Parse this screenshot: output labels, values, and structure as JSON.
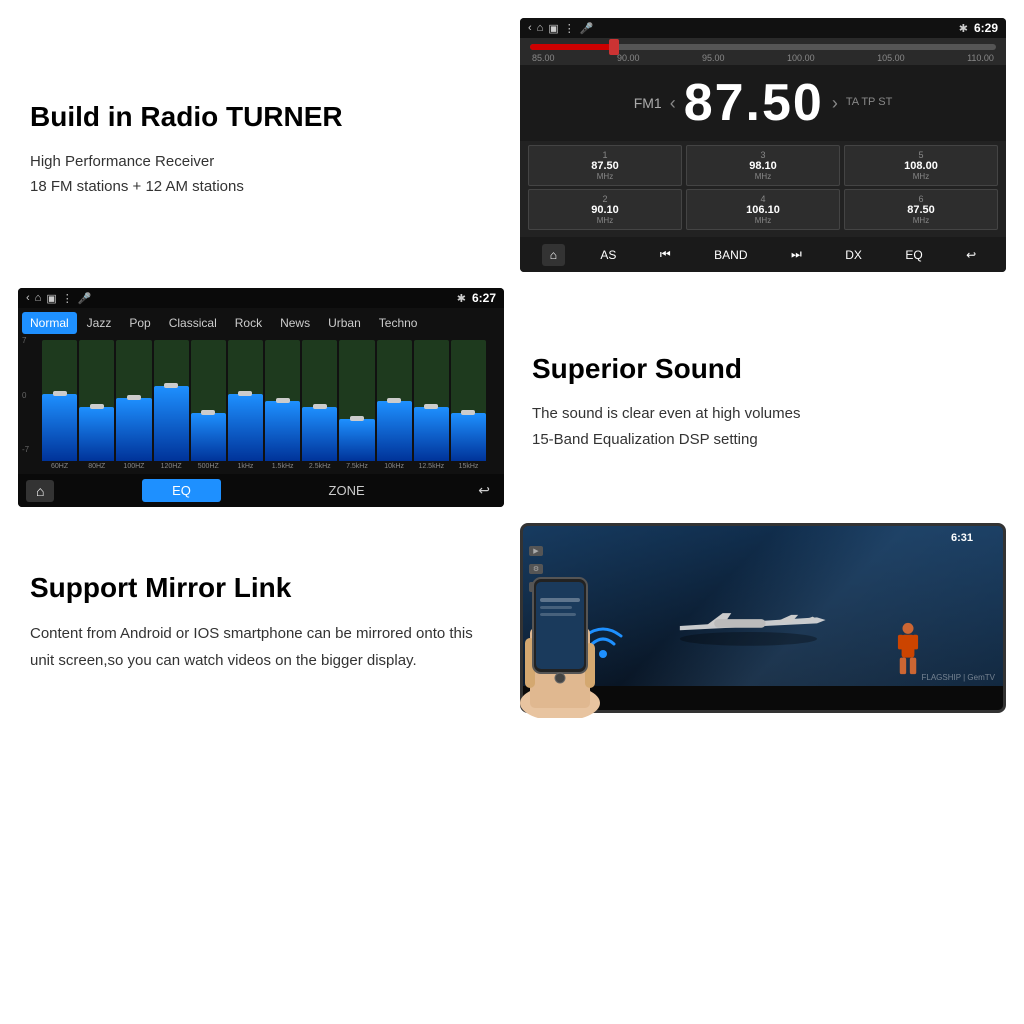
{
  "sections": {
    "radio": {
      "title": "Build in Radio TURNER",
      "desc1": "High Performance Receiver",
      "desc2": "18 FM stations + 12 AM stations",
      "ui": {
        "time": "6:29",
        "band": "FM1",
        "freq": "87.50",
        "arrows": [
          "‹",
          "›"
        ],
        "tags": "TA TP ST",
        "seekLabels": [
          "85.00",
          "90.00",
          "95.00",
          "100.00",
          "105.00",
          "110.00"
        ],
        "presets": [
          {
            "num": "1",
            "freq": "87.50",
            "unit": "MHz"
          },
          {
            "num": "3",
            "freq": "98.10",
            "unit": "MHz"
          },
          {
            "num": "5",
            "freq": "108.00",
            "unit": "MHz"
          },
          {
            "num": "2",
            "freq": "90.10",
            "unit": "MHz"
          },
          {
            "num": "4",
            "freq": "106.10",
            "unit": "MHz"
          },
          {
            "num": "6",
            "freq": "87.50",
            "unit": "MHz"
          }
        ],
        "controls": [
          "⌂",
          "AS",
          "⏮",
          "BAND",
          "⏭",
          "DX",
          "EQ",
          "↩"
        ]
      }
    },
    "eq": {
      "title": "Superior Sound",
      "desc1": "The sound is clear even at high volumes",
      "desc2": "15-Band Equalization DSP setting",
      "ui": {
        "time": "6:27",
        "modes": [
          "Normal",
          "Jazz",
          "Pop",
          "Classical",
          "Rock",
          "News",
          "Urban",
          "Techno"
        ],
        "activeMode": "Normal",
        "bands": [
          {
            "label": "60HZ",
            "fillPct": 55,
            "thumbPct": 55
          },
          {
            "label": "80HZ",
            "fillPct": 45,
            "thumbPct": 45
          },
          {
            "label": "100HZ",
            "fillPct": 50,
            "thumbPct": 50
          },
          {
            "label": "120HZ",
            "fillPct": 60,
            "thumbPct": 60
          },
          {
            "label": "500HZ",
            "fillPct": 40,
            "thumbPct": 40
          },
          {
            "label": "1kHz",
            "fillPct": 55,
            "thumbPct": 55
          },
          {
            "label": "1.5kHz",
            "fillPct": 50,
            "thumbPct": 50
          },
          {
            "label": "2.5kHz",
            "fillPct": 45,
            "thumbPct": 45
          },
          {
            "label": "7.5kHz",
            "fillPct": 35,
            "thumbPct": 35
          },
          {
            "label": "10kHz",
            "fillPct": 50,
            "thumbPct": 50
          },
          {
            "label": "12.5kHz",
            "fillPct": 45,
            "thumbPct": 45
          },
          {
            "label": "15kHz",
            "fillPct": 40,
            "thumbPct": 40
          }
        ],
        "scaleTop": "7",
        "scaleMid": "0",
        "scaleBot": "-7",
        "buttons": {
          "eq": "EQ",
          "zone": "ZONE"
        }
      }
    },
    "mirror": {
      "title": "Support Mirror Link",
      "desc": "Content from Android or IOS smartphone can be mirrored onto this unit screen,so you can watch videos on the  bigger display.",
      "ui": {
        "time": "6:31",
        "watermark": "FLAGSHIP | GemTV"
      }
    }
  }
}
